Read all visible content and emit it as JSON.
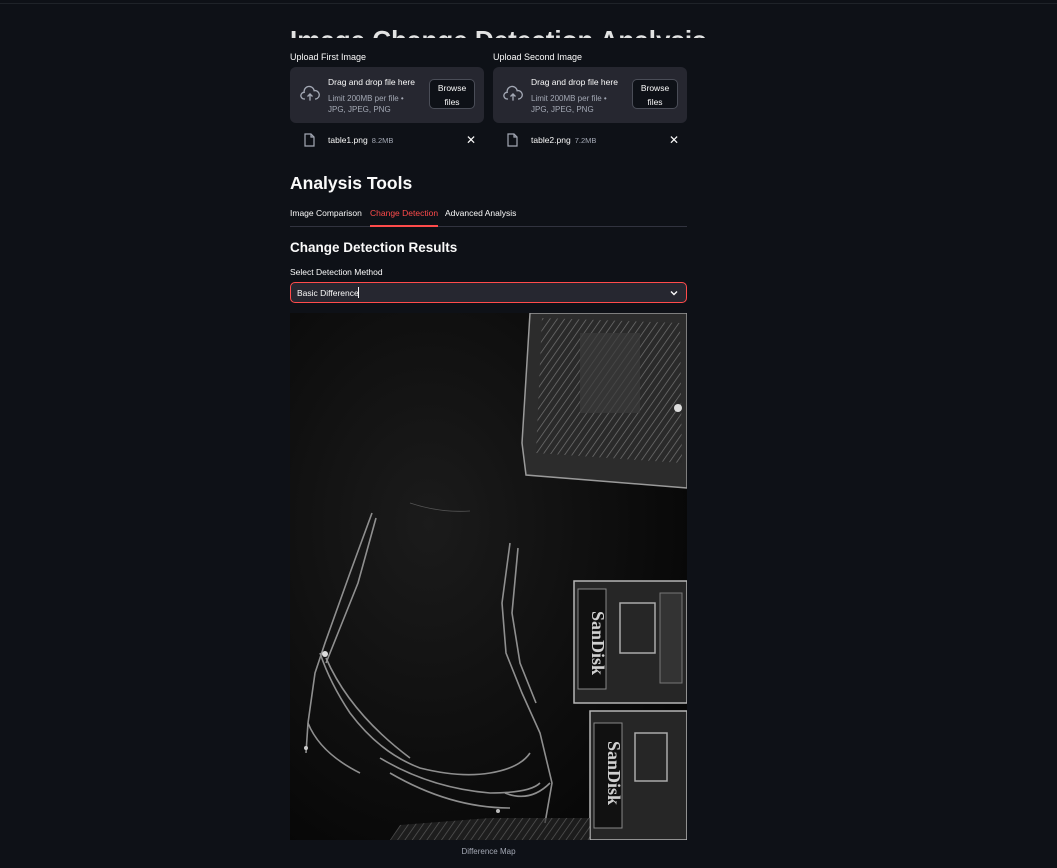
{
  "app": {
    "partial_title": "Image Change Detection Analysis"
  },
  "uploaders": [
    {
      "label": "Upload First Image",
      "drop_title": "Drag and drop file here",
      "drop_sub": "Limit 200MB per file • JPG, JPEG, PNG",
      "browse_label": "Browse files",
      "file": {
        "name": "table1.png",
        "size": "8.2MB"
      }
    },
    {
      "label": "Upload Second Image",
      "drop_title": "Drag and drop file here",
      "drop_sub": "Limit 200MB per file • JPG, JPEG, PNG",
      "browse_label": "Browse files",
      "file": {
        "name": "table2.png",
        "size": "7.2MB"
      }
    }
  ],
  "analysis": {
    "heading": "Analysis Tools",
    "tabs": [
      {
        "label": "Image Comparison",
        "active": false
      },
      {
        "label": "Change Detection",
        "active": true
      },
      {
        "label": "Advanced Analysis",
        "active": false
      }
    ],
    "results_heading": "Change Detection Results",
    "method_label": "Select Detection Method",
    "method_value": "Basic Difference",
    "image_caption": "Difference Map"
  },
  "colors": {
    "background": "#0e1117",
    "accent": "#ff4b4b",
    "panel": "#262730"
  },
  "icons": {
    "upload": "cloud-upload-icon",
    "file": "file-icon",
    "remove": "close-icon",
    "dropdown": "chevron-down-icon"
  }
}
